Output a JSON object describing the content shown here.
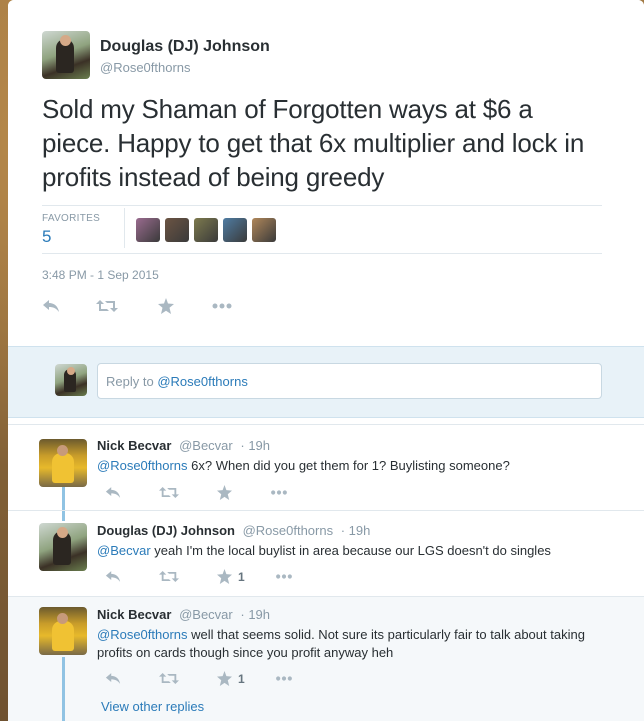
{
  "tweet": {
    "author_name": "Douglas (DJ) Johnson",
    "author_handle": "@Rose0fthorns",
    "text": "Sold my Shaman of Forgotten ways at $6 a piece. Happy to get that 6x multiplier and lock in profits instead of being greedy",
    "favorites_label": "FAVORITES",
    "favorites_count": "5",
    "timestamp": "3:48 PM - 1 Sep 2015",
    "favoriter_colors": [
      "#9a6b8f",
      "#6b5443",
      "#7d7a4e",
      "#4f7ca3",
      "#b0875a"
    ]
  },
  "reply_box": {
    "prefix": "Reply to ",
    "handle": "@Rose0fthorns"
  },
  "replies": [
    {
      "name": "Nick Becvar",
      "handle": "@Becvar",
      "time": "· 19h",
      "mention": "@Rose0fthorns",
      "text": " 6x? When did you get them for 1? Buylisting someone?",
      "fav_count": ""
    },
    {
      "name": "Douglas (DJ) Johnson",
      "handle": "@Rose0fthorns",
      "time": "· 19h",
      "mention": "@Becvar",
      "text": " yeah I'm the local buylist in area because our LGS doesn't do singles",
      "fav_count": "1"
    },
    {
      "name": "Nick Becvar",
      "handle": "@Becvar",
      "time": "· 19h",
      "mention": "@Rose0fthorns",
      "text": " well that seems solid. Not sure its particularly fair to talk about taking profits on cards though since you profit anyway heh",
      "fav_count": "1"
    }
  ],
  "view_more": "View other replies",
  "colors": {
    "link": "#2b7bb9",
    "text": "#292f33",
    "muted": "#8899a6",
    "icon": "#aab8c2",
    "thread_line": "#90c3e3",
    "reply_box_bg": "#e8f2f8"
  }
}
